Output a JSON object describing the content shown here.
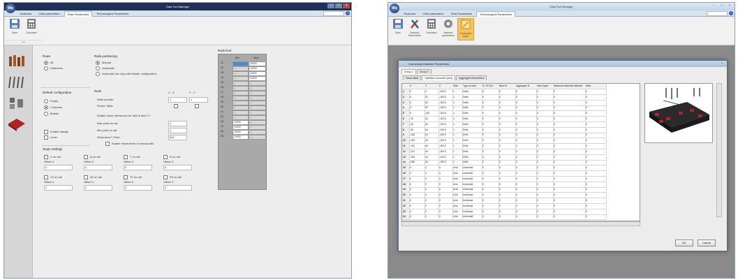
{
  "window1": {
    "title": "Gaia Tool Manager",
    "app_logo": "Wq",
    "tabs": [
      "Toolchest",
      "Cloth parameters",
      "Rails Parameters",
      "Technological Parameters"
    ],
    "active_tab": 2,
    "ribbon": {
      "buttons": [
        {
          "label": "Save",
          "icon": "save-icon"
        },
        {
          "label": "Calculator",
          "icon": "calculator-icon"
        }
      ],
      "group_label": "File"
    },
    "rows_group": {
      "title": "Rows",
      "options": [
        "All",
        "Rubberize"
      ],
      "selected": 0
    },
    "rails_positioning": {
      "title": "Rails positioning",
      "options": [
        "Manual",
        "Automatic",
        "Automatic but only with Builder configuration"
      ],
      "selected": 0
    },
    "default_config": {
      "title": "Default configuration",
      "options": [
        "Empty",
        "Customer",
        "Builder"
      ],
      "selected": 1,
      "checkboxes": [
        "Enable display",
        "Lever"
      ]
    },
    "rails_group": {
      "title": "Rails",
      "col_a": "X - X",
      "col_b": "Y - Y",
      "rows": [
        {
          "label": "Rails number",
          "a": "1",
          "b": "1"
        },
        {
          "label": "Router Table",
          "a": "",
          "b": ""
        },
        {
          "label": "Enable minor references for rails in field Y+",
          "a": "",
          "b": ""
        },
        {
          "label": "Max pods on rail",
          "a": "4",
          "b": ""
        },
        {
          "label": "Min pods on rail",
          "a": "1",
          "b": ""
        },
        {
          "label": "Dimension Y Field",
          "a": "500",
          "b": ""
        }
      ],
      "enable_checkbox": "Enable movements of central rails"
    },
    "stops_settings": {
      "title": "Stops settings",
      "row1": [
        {
          "check": "X on rail",
          "offset_label": "Offset X",
          "value": "0"
        },
        {
          "check": "A on rail",
          "offset_label": "Offset X",
          "value": "0"
        },
        {
          "check": "T on rail",
          "offset_label": "Offset X",
          "value": "0"
        },
        {
          "check": "R on rail",
          "offset_label": "Offset X",
          "value": "0"
        }
      ],
      "row2": [
        {
          "check": "X2 on rail",
          "offset_label": "Offset X",
          "value": "0"
        },
        {
          "check": "A2 on rail",
          "offset_label": "Offset X",
          "value": "0"
        },
        {
          "check": "T2 on rail",
          "offset_label": "Offset X",
          "value": "0"
        },
        {
          "check": "R2 on rail",
          "offset_label": "Offset X",
          "value": "0"
        }
      ]
    },
    "rails_limit": {
      "title": "Rails limit",
      "col_min": "Min",
      "col_max": "Max",
      "rows": [
        {
          "n": "11",
          "min": "",
          "max": "10000"
        },
        {
          "n": "12",
          "min": "---",
          "max": "10000"
        },
        {
          "n": "13",
          "min": "---",
          "max": "10000"
        },
        {
          "n": "14",
          "min": "---",
          "max": "10000"
        },
        {
          "n": "15",
          "min": "---",
          "max": "---"
        },
        {
          "n": "16",
          "min": "---",
          "max": "---"
        },
        {
          "n": "17",
          "min": "---",
          "max": "---"
        },
        {
          "n": "18",
          "min": "---",
          "max": "---"
        },
        {
          "n": "19",
          "min": "---",
          "max": "---"
        },
        {
          "n": "20",
          "min": "---",
          "max": "---"
        },
        {
          "n": "21",
          "min": "---",
          "max": "---"
        },
        {
          "n": "22",
          "min": "---",
          "max": "---"
        },
        {
          "n": "23",
          "min": "10000",
          "max": "---"
        },
        {
          "n": "24",
          "min": "10000",
          "max": "---"
        },
        {
          "n": "25",
          "min": "10000",
          "max": "---"
        },
        {
          "n": "26",
          "min": "10000",
          "max": "---"
        }
      ]
    }
  },
  "window2": {
    "title": "Gaia Tool Manager",
    "app_logo": "Wq",
    "tabs": [
      "Toolchest",
      "Cloth parameters",
      "Rails Parameters",
      "Technological Parameters"
    ],
    "active_tab": 3,
    "ribbon": {
      "buttons": [
        {
          "label": "Save",
          "icon": "save-icon"
        },
        {
          "label": "Network Parameters",
          "icon": "tools-icon"
        },
        {
          "label": "Calculator",
          "icon": "calculator-icon"
        },
        {
          "label": "Network parameters",
          "icon": "gear-icon"
        },
        {
          "label": "Connected tools",
          "icon": "connected-tools-icon"
        }
      ]
    },
    "dialog": {
      "title": "Connection Machine Parameters",
      "group_tabs": [
        "Group 1",
        "Group 2"
      ],
      "sub_tabs": [
        "Head offset",
        "Spindles correction (mm)",
        "Aggregate Parameters"
      ],
      "columns": [
        "",
        "X",
        "Y",
        "Z",
        "Side",
        "Type of work",
        "N. Of Tool",
        "Back N.",
        "Aggregate N.",
        "Max Depth",
        "Maximum diameter allowed",
        "Maxi"
      ],
      "rows": [
        [
          "1",
          "0",
          "0",
          "-150.6",
          "1",
          "Drills",
          "0",
          "0",
          "0",
          "0",
          "0",
          "0"
        ],
        [
          "2",
          "0",
          "32",
          "-150.6",
          "1",
          "Drills",
          "0",
          "0",
          "0",
          "0",
          "0",
          "0"
        ],
        [
          "3",
          "0",
          "64",
          "-150.6",
          "1",
          "Drills",
          "0",
          "0",
          "0",
          "0",
          "0",
          "0"
        ],
        [
          "4",
          "0",
          "96",
          "-150.6",
          "1",
          "Drills",
          "0",
          "0",
          "0",
          "0",
          "0",
          "0"
        ],
        [
          "5",
          "0",
          "128",
          "-150.6",
          "1",
          "Drills",
          "0",
          "0",
          "0",
          "0",
          "0",
          "0"
        ],
        [
          "6",
          "-32",
          "64",
          "-150.6",
          "1",
          "Drills",
          "0",
          "0",
          "0",
          "0",
          "0",
          "0"
        ],
        [
          "7",
          "-64",
          "64",
          "-150.6",
          "1",
          "Drills",
          "0",
          "0",
          "0",
          "0",
          "0",
          "0"
        ],
        [
          "8",
          "-96",
          "64",
          "-150.6",
          "1",
          "Drills",
          "0",
          "0",
          "0",
          "0",
          "0",
          "0"
        ],
        [
          "9",
          "-128",
          "64",
          "-150.6",
          "1",
          "Drills",
          "0",
          "0",
          "0",
          "0",
          "0",
          "0"
        ],
        [
          "10",
          "-160",
          "64",
          "-150.6",
          "1",
          "Drills",
          "0",
          "0",
          "0",
          "0",
          "0",
          "0"
        ],
        [
          "11",
          "-192",
          "64",
          "-150.6",
          "1",
          "Drills",
          "0",
          "0",
          "0",
          "0",
          "0",
          "0"
        ],
        [
          "12",
          "-224",
          "64",
          "-150.6",
          "1",
          "Drills",
          "0",
          "0",
          "0",
          "0",
          "0",
          "0"
        ],
        [
          "13",
          "-256",
          "64",
          "-150.6",
          "1",
          "Drills",
          "0",
          "0",
          "0",
          "0",
          "0",
          "0"
        ],
        [
          "14",
          "-288",
          "64",
          "-150.6",
          "1",
          "Drills",
          "0",
          "0",
          "0",
          "0",
          "0",
          "0"
        ],
        [
          "15",
          "0",
          "0",
          "0",
          "Univ.",
          "Universal",
          "0",
          "0",
          "0",
          "0",
          "0",
          "0"
        ],
        [
          "16",
          "0",
          "0",
          "0",
          "Univ.",
          "Universal",
          "0",
          "0",
          "0",
          "0",
          "0",
          "0"
        ],
        [
          "17",
          "0",
          "0",
          "0",
          "Univ.",
          "Universal",
          "0",
          "0",
          "0",
          "0",
          "0",
          "0"
        ],
        [
          "18",
          "0",
          "0",
          "0",
          "Univ.",
          "Universal",
          "0",
          "0",
          "0",
          "0",
          "0",
          "0"
        ],
        [
          "19",
          "0",
          "0",
          "0",
          "Univ.",
          "Universal",
          "0",
          "0",
          "0",
          "0",
          "0",
          "0"
        ],
        [
          "20",
          "0",
          "0",
          "0",
          "Univ.",
          "Universal",
          "0",
          "0",
          "0",
          "0",
          "0",
          "0"
        ],
        [
          "21",
          "0",
          "0",
          "0",
          "Univ.",
          "Universal",
          "0",
          "0",
          "0",
          "0",
          "0",
          "0"
        ],
        [
          "22",
          "0",
          "0",
          "0",
          "Univ.",
          "Universal",
          "0",
          "0",
          "0",
          "0",
          "0",
          "0"
        ],
        [
          "23",
          "0",
          "0",
          "0",
          "Univ.",
          "Universal",
          "0",
          "0",
          "0",
          "0",
          "0",
          "0"
        ],
        [
          "24",
          "0",
          "0",
          "0",
          "Univ.",
          "Universal",
          "0",
          "0",
          "0",
          "0",
          "0",
          "0"
        ]
      ],
      "ok_label": "OK",
      "cancel_label": "Cancel"
    }
  },
  "colors": {
    "title_dark": "#1f2f55",
    "title_light": "#c3d3e8",
    "selection": "#3e8ee2",
    "machine_red": "#b0232a",
    "connected_tools_highlight": "#f6c35c"
  }
}
